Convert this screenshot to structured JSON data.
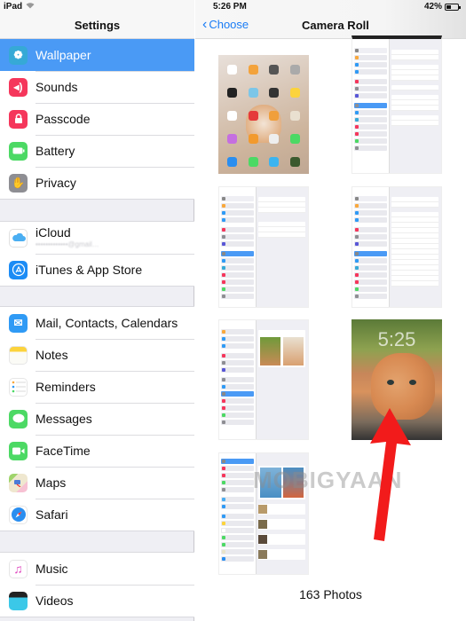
{
  "status_bar": {
    "device": "iPad",
    "wifi_icon": "wifi-icon",
    "time": "5:26 PM",
    "battery_percent": "42%",
    "battery_level": 0.42
  },
  "settings_panel": {
    "title": "Settings",
    "groups": [
      {
        "items": [
          {
            "label": "Wallpaper",
            "icon": "wallpaper-icon",
            "color": "#36a9d6",
            "selected": true
          },
          {
            "label": "Sounds",
            "icon": "speaker-icon",
            "color": "#f5365b"
          },
          {
            "label": "Passcode",
            "icon": "lock-icon",
            "color": "#f5365b"
          },
          {
            "label": "Battery",
            "icon": "battery-icon",
            "color": "#4cd964"
          },
          {
            "label": "Privacy",
            "icon": "hand-icon",
            "color": "#8e8e93"
          }
        ]
      },
      {
        "items": [
          {
            "label": "iCloud",
            "sublabel": "•••••••••••••@gmail…",
            "icon": "icloud-icon",
            "color": "#ffffff"
          },
          {
            "label": "iTunes & App Store",
            "icon": "app-store-icon",
            "color": "#1c8cf5"
          }
        ]
      },
      {
        "items": [
          {
            "label": "Mail, Contacts, Calendars",
            "icon": "mail-icon",
            "color": "#2f9af5"
          },
          {
            "label": "Notes",
            "icon": "notes-icon",
            "color": "#fcd33c"
          },
          {
            "label": "Reminders",
            "icon": "reminders-icon",
            "color": "#ffffff"
          },
          {
            "label": "Messages",
            "icon": "messages-icon",
            "color": "#4cd964"
          },
          {
            "label": "FaceTime",
            "icon": "facetime-icon",
            "color": "#4cd964"
          },
          {
            "label": "Maps",
            "icon": "maps-icon",
            "color": "#e9e3c9"
          },
          {
            "label": "Safari",
            "icon": "safari-icon",
            "color": "#ffffff"
          }
        ]
      },
      {
        "items": [
          {
            "label": "Music",
            "icon": "music-icon",
            "color": "#ffffff"
          },
          {
            "label": "Videos",
            "icon": "videos-icon",
            "color": "#3bc8e8"
          }
        ]
      }
    ]
  },
  "camera_roll": {
    "back_label": "Choose",
    "title": "Camera Roll",
    "photo_count": "163 Photos",
    "watermark": "MOBIGYAAN",
    "accent": "#1a7cf5",
    "thumbnails": [
      {
        "kind": "home-screen"
      },
      {
        "kind": "settings-general"
      },
      {
        "kind": "settings-storage"
      },
      {
        "kind": "settings-storage-apps"
      },
      {
        "kind": "settings-wallpaper"
      },
      {
        "kind": "lock-screen-kitten",
        "lock_time": "5:25"
      },
      {
        "kind": "wallpaper-choose"
      }
    ]
  }
}
